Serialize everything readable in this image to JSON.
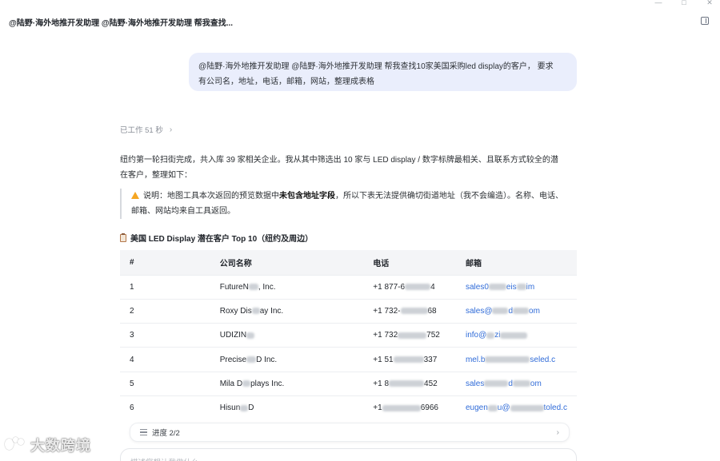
{
  "window": {
    "controls": [
      "—",
      "□",
      "✕"
    ]
  },
  "header": {
    "title": "@陆野·海外地推开发助理 @陆野·海外地推开发助理 帮我查找..."
  },
  "user_message": {
    "line1": "@陆野·海外地推开发助理 @陆野·海外地推开发助理 帮我查找10家美国采购led display的客户， 要求",
    "line2": "有公司名，地址，电话，邮箱，网站，整理成表格"
  },
  "assistant": {
    "worked_label": "已工作 51 秒",
    "intro_line1": "纽约第一轮扫街完成，共入库 39 家相关企业。我从其中筛选出 10 家与 LED display / 数字标牌最相关、且联系方式较全的潜",
    "intro_line2": "在客户，整理如下：",
    "note_pre": "说明：地图工具本次返回的预览数据中",
    "note_bold": "未包含地址字段",
    "note_post": "，所以下表无法提供确切街道地址（我不会编造）。名称、电话、",
    "note_line2": "邮箱、网站均来自工具返回。",
    "table_title": "美国 LED Display 潜在客户 Top 10（纽约及周边）"
  },
  "table": {
    "headers": [
      "#",
      "公司名称",
      "电话",
      "邮箱"
    ],
    "rows": [
      {
        "num": "1",
        "name_a": "FutureN",
        "name_b": ", Inc.",
        "phone_a": "+1 877-6",
        "phone_b": "4",
        "email_a": "sales0",
        "email_b": "eis",
        "email_c": "im"
      },
      {
        "num": "2",
        "name_a": "Roxy Dis",
        "name_b": "ay Inc.",
        "phone_a": "+1 732-",
        "phone_b": "68",
        "email_a": "sales@",
        "email_b": "d",
        "email_c": "om"
      },
      {
        "num": "3",
        "name_a": "UDIZIN",
        "name_b": "",
        "phone_a": "+1 732",
        "phone_b": "752",
        "email_a": "info@",
        "email_b": "zi",
        "email_c": ""
      },
      {
        "num": "4",
        "name_a": "Precise",
        "name_b": "D Inc.",
        "phone_a": "+1 51",
        "phone_b": "337",
        "email_a": "mel.b",
        "email_b": "",
        "email_c": "seled.c"
      },
      {
        "num": "5",
        "name_a": "Mila D",
        "name_b": "plays Inc.",
        "phone_a": "+1 8",
        "phone_b": "452",
        "email_a": "sales",
        "email_b": "d",
        "email_c": "om"
      },
      {
        "num": "6",
        "name_a": "Hisun",
        "name_b": "D",
        "phone_a": "+1",
        "phone_b": "6966",
        "email_a": "eugen",
        "email_b": "u@",
        "email_c": "toled.c"
      }
    ]
  },
  "progress": {
    "label": "进度 2/2"
  },
  "input": {
    "placeholder": "描述您想让我做什么..."
  },
  "watermark": {
    "text": "大数跨境"
  },
  "colors": {
    "accent_link": "#2f6bd8",
    "bubble_bg": "#eaeefc",
    "warn": "#f5a623"
  }
}
